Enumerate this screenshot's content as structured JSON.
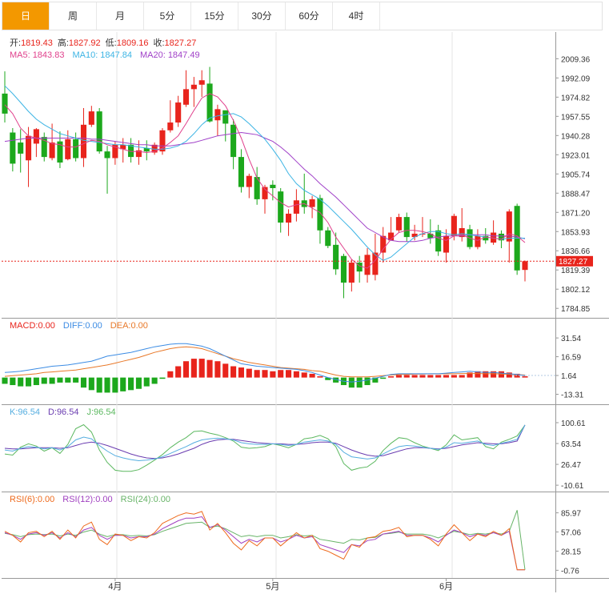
{
  "tabs": [
    {
      "label": "日",
      "active": true
    },
    {
      "label": "周",
      "active": false
    },
    {
      "label": "月",
      "active": false
    },
    {
      "label": "5分",
      "active": false
    },
    {
      "label": "15分",
      "active": false
    },
    {
      "label": "30分",
      "active": false
    },
    {
      "label": "60分",
      "active": false
    },
    {
      "label": "4时",
      "active": false
    }
  ],
  "colors": {
    "up": "#e8241c",
    "down": "#1ca81c",
    "ma5": "#e0408c",
    "ma10": "#3cb4e4",
    "ma20": "#a040c8",
    "diff": "#3c8ce4",
    "dea": "#e87828",
    "k": "#56aee0",
    "d": "#6a3cb0",
    "j": "#5cb860",
    "rsi6": "#ee6a1c",
    "rsi12": "#a040c0",
    "rsi24": "#68b468"
  },
  "ohlc": {
    "open_label": "开:",
    "open": "1819.43",
    "high_label": "高:",
    "high": "1827.92",
    "low_label": "低:",
    "low": "1809.16",
    "close_label": "收:",
    "close": "1827.27"
  },
  "ma": {
    "ma5_label": "MA5:",
    "ma5": "1843.83",
    "ma10_label": "MA10:",
    "ma10": "1847.84",
    "ma20_label": "MA20:",
    "ma20": "1847.49"
  },
  "macd_legend": {
    "macd_label": "MACD:",
    "macd": "0.00",
    "diff_label": "DIFF:",
    "diff": "0.00",
    "dea_label": "DEA:",
    "dea": "0.00"
  },
  "kdj_legend": {
    "k_label": "K:",
    "k": "96.54",
    "d_label": "D:",
    "d": "96.54",
    "j_label": "J:",
    "j": "96.54"
  },
  "rsi_legend": {
    "rsi6_label": "RSI(6):",
    "rsi6": "0.00",
    "rsi12_label": "RSI(12):",
    "rsi12": "0.00",
    "rsi24_label": "RSI(24):",
    "rsi24": "0.00"
  },
  "current_price_label": "1827.27",
  "chart_data": [
    {
      "type": "candlestick",
      "panel": "price",
      "ylim": [
        1777.8,
        2030.5
      ],
      "yticks": [
        "2009.36",
        "1992.09",
        "1974.82",
        "1957.55",
        "1940.28",
        "1923.01",
        "1905.74",
        "1888.47",
        "1871.20",
        "1853.93",
        "1836.66",
        "1819.39",
        "1802.12",
        "1784.85"
      ],
      "xticks": [
        {
          "label": "4月",
          "index": 14
        },
        {
          "label": "5月",
          "index": 34
        },
        {
          "label": "6月",
          "index": 56
        }
      ],
      "candles": [
        [
          1978,
          1960,
          1998,
          1952
        ],
        [
          1943,
          1915,
          1947,
          1908
        ],
        [
          1934,
          1924,
          1946,
          1907
        ],
        [
          1918,
          1940,
          1948,
          1894
        ],
        [
          1933,
          1946,
          1947,
          1921
        ],
        [
          1939,
          1921,
          1943,
          1917
        ],
        [
          1920,
          1934,
          1951,
          1918
        ],
        [
          1935,
          1916,
          1944,
          1911
        ],
        [
          1919,
          1937,
          1945,
          1918
        ],
        [
          1937,
          1920,
          1943,
          1917
        ],
        [
          1920,
          1950,
          1965,
          1912
        ],
        [
          1950,
          1962,
          1967,
          1948
        ],
        [
          1962,
          1926,
          1965,
          1924
        ],
        [
          1926,
          1920,
          1931,
          1888
        ],
        [
          1920,
          1932,
          1935,
          1914
        ],
        [
          1928,
          1932,
          1938,
          1916
        ],
        [
          1932,
          1921,
          1938,
          1916
        ],
        [
          1921,
          1927,
          1936,
          1914
        ],
        [
          1929,
          1926,
          1936,
          1918
        ],
        [
          1925,
          1932,
          1934,
          1923
        ],
        [
          1926,
          1945,
          1947,
          1923
        ],
        [
          1945,
          1952,
          1972,
          1943
        ],
        [
          1952,
          1970,
          1976,
          1948
        ],
        [
          1968,
          1982,
          1999,
          1966
        ],
        [
          1982,
          1986,
          1993,
          1966
        ],
        [
          1986,
          1990,
          1999,
          1975
        ],
        [
          1987,
          1953,
          2002,
          1952
        ],
        [
          1954,
          1964,
          1968,
          1940
        ],
        [
          1963,
          1951,
          1960,
          1935
        ],
        [
          1950,
          1921,
          1955,
          1910
        ],
        [
          1921,
          1894,
          1928,
          1889
        ],
        [
          1894,
          1904,
          1906,
          1884
        ],
        [
          1903,
          1883,
          1912,
          1878
        ],
        [
          1883,
          1894,
          1896,
          1870
        ],
        [
          1896,
          1893,
          1900,
          1882
        ],
        [
          1890,
          1862,
          1893,
          1853
        ],
        [
          1862,
          1870,
          1874,
          1850
        ],
        [
          1870,
          1882,
          1892,
          1863
        ],
        [
          1882,
          1876,
          1906,
          1870
        ],
        [
          1876,
          1883,
          1886,
          1866
        ],
        [
          1884,
          1855,
          1887,
          1843
        ],
        [
          1855,
          1841,
          1858,
          1839
        ],
        [
          1842,
          1820,
          1853,
          1815
        ],
        [
          1832,
          1808,
          1834,
          1794
        ],
        [
          1808,
          1826,
          1829,
          1800
        ],
        [
          1826,
          1818,
          1832,
          1808
        ],
        [
          1815,
          1833,
          1839,
          1808
        ],
        [
          1815,
          1835,
          1852,
          1810
        ],
        [
          1835,
          1850,
          1858,
          1826
        ],
        [
          1846,
          1853,
          1867,
          1848
        ],
        [
          1855,
          1867,
          1870,
          1853
        ],
        [
          1867,
          1849,
          1871,
          1845
        ],
        [
          1849,
          1852,
          1860,
          1846
        ],
        [
          1852,
          1852,
          1867,
          1849
        ],
        [
          1852,
          1848,
          1865,
          1843
        ],
        [
          1855,
          1836,
          1860,
          1832
        ],
        [
          1835,
          1850,
          1856,
          1826
        ],
        [
          1850,
          1868,
          1870,
          1846
        ],
        [
          1849,
          1857,
          1875,
          1845
        ],
        [
          1856,
          1840,
          1860,
          1838
        ],
        [
          1840,
          1850,
          1856,
          1838
        ],
        [
          1850,
          1846,
          1857,
          1843
        ],
        [
          1844,
          1853,
          1864,
          1842
        ],
        [
          1852,
          1846,
          1855,
          1839
        ],
        [
          1845,
          1872,
          1874,
          1826
        ],
        [
          1877,
          1819,
          1879,
          1815
        ],
        [
          1819.43,
          1827.27,
          1827.92,
          1809.16
        ]
      ],
      "ma5": [
        1968,
        1960,
        1947,
        1940,
        1938,
        1936,
        1933,
        1932,
        1930,
        1930,
        1933,
        1936,
        1935,
        1932,
        1930,
        1928,
        1926,
        1926,
        1925,
        1926,
        1929,
        1934,
        1940,
        1951,
        1963,
        1974,
        1978,
        1975,
        1967,
        1954,
        1938,
        1919,
        1902,
        1892,
        1886,
        1880,
        1876,
        1878,
        1879,
        1875,
        1871,
        1862,
        1849,
        1839,
        1829,
        1823,
        1821,
        1828,
        1838,
        1847,
        1853,
        1855,
        1855,
        1854,
        1852,
        1848,
        1846,
        1850,
        1851,
        1848,
        1846,
        1849,
        1848,
        1847,
        1852,
        1850,
        1844
      ],
      "ma10": [
        1985,
        1978,
        1970,
        1962,
        1955,
        1950,
        1946,
        1942,
        1940,
        1938,
        1936,
        1935,
        1934,
        1933,
        1932,
        1932,
        1931,
        1930,
        1929,
        1928,
        1928,
        1929,
        1931,
        1935,
        1942,
        1950,
        1956,
        1958,
        1959,
        1960,
        1957,
        1951,
        1944,
        1937,
        1928,
        1918,
        1906,
        1897,
        1891,
        1887,
        1883,
        1877,
        1870,
        1863,
        1856,
        1848,
        1840,
        1833,
        1828,
        1831,
        1837,
        1843,
        1849,
        1852,
        1854,
        1854,
        1852,
        1851,
        1852,
        1851,
        1850,
        1849,
        1848,
        1847,
        1848,
        1848,
        1848
      ],
      "ma20": [
        1935,
        1936,
        1937,
        1938,
        1938,
        1938,
        1938,
        1938,
        1938,
        1938,
        1938,
        1937,
        1937,
        1936,
        1935,
        1934,
        1933,
        1932,
        1932,
        1931,
        1931,
        1931,
        1932,
        1933,
        1934,
        1936,
        1938,
        1940,
        1941,
        1942,
        1943,
        1942,
        1941,
        1938,
        1935,
        1930,
        1924,
        1917,
        1910,
        1904,
        1897,
        1891,
        1885,
        1878,
        1871,
        1864,
        1857,
        1853,
        1849,
        1846,
        1845,
        1845,
        1845,
        1846,
        1848,
        1849,
        1850,
        1850,
        1850,
        1851,
        1851,
        1851,
        1850,
        1850,
        1850,
        1849,
        1847.5
      ]
    },
    {
      "type": "macd",
      "panel": "macd",
      "ylim": [
        -20.0,
        38.0
      ],
      "yticks": [
        "31.54",
        "16.59",
        "1.64",
        "-13.31"
      ],
      "macd": [
        -5,
        -6,
        -7,
        -7,
        -6,
        -5,
        -5,
        -4,
        -4,
        -4,
        -8,
        -10,
        -12,
        -12,
        -12,
        -11,
        -10,
        -9,
        -7,
        -5,
        -1,
        5,
        9,
        13,
        15,
        15,
        14,
        13,
        11,
        9,
        8,
        7,
        6,
        6,
        5,
        6,
        6,
        5,
        4,
        3,
        1,
        -2,
        -4,
        -6,
        -8,
        -8,
        -6,
        -4,
        -1,
        1,
        2,
        2,
        2,
        2,
        2,
        2,
        2,
        2,
        2,
        4,
        5,
        5,
        5,
        5,
        4,
        3,
        1
      ],
      "diff": [
        4,
        4.5,
        5,
        6,
        7,
        8,
        9,
        9.5,
        10,
        11,
        12,
        13,
        15,
        17,
        18,
        19,
        20,
        21.5,
        23,
        24.5,
        25.5,
        26.5,
        27,
        27,
        26,
        25,
        23,
        20,
        17,
        14,
        11,
        10,
        9,
        8.5,
        8,
        7.5,
        7,
        6.5,
        5.5,
        4,
        2,
        0,
        -1.5,
        -3,
        -3.5,
        -3,
        -2,
        -0.5,
        1,
        2.5,
        3,
        3,
        3,
        3,
        3,
        3,
        3.5,
        4,
        4.5,
        5,
        4.5,
        4,
        4,
        3.5,
        3,
        2.5,
        1.5
      ],
      "dea": [
        1,
        1.5,
        2,
        2.5,
        3,
        4,
        4.5,
        5,
        5.5,
        6,
        7,
        8,
        9,
        10,
        11.5,
        13,
        14.5,
        16,
        18,
        20,
        21.5,
        23,
        24,
        24.5,
        24,
        23,
        21,
        19,
        17,
        15,
        13.5,
        12,
        11,
        10,
        9,
        8,
        7.5,
        7,
        6.5,
        5.5,
        5,
        3.5,
        2,
        1,
        0.5,
        0.5,
        0.5,
        1,
        1.5,
        2,
        2.5,
        2.5,
        2.8,
        2.8,
        3,
        3,
        3,
        3,
        3.2,
        3.2,
        3.2,
        3,
        3,
        2.8,
        2.6,
        2.4,
        2
      ]
    },
    {
      "type": "kdj",
      "panel": "kdj",
      "ylim": [
        -19.0,
        112.0
      ],
      "yticks": [
        "100.61",
        "63.54",
        "26.47",
        "-10.61"
      ],
      "k": [
        52,
        50,
        55,
        58,
        57,
        54,
        56,
        52,
        58,
        70,
        75,
        72,
        60,
        50,
        42,
        38,
        35,
        33,
        34,
        36,
        40,
        46,
        52,
        58,
        65,
        70,
        72,
        73,
        72,
        70,
        65,
        63,
        62,
        62,
        63,
        62,
        60,
        62,
        66,
        68,
        70,
        68,
        62,
        48,
        40,
        38,
        36,
        38,
        45,
        52,
        58,
        60,
        59,
        57,
        55,
        53,
        57,
        65,
        64,
        66,
        68,
        62,
        60,
        64,
        67,
        71,
        96.5
      ],
      "d": [
        55,
        54,
        54,
        55,
        56,
        56,
        56,
        55,
        56,
        60,
        64,
        66,
        64,
        60,
        55,
        50,
        45,
        41,
        38,
        37,
        38,
        41,
        45,
        50,
        55,
        62,
        67,
        70,
        71,
        71,
        69,
        67,
        65,
        64,
        63,
        63,
        62,
        62,
        63,
        65,
        66,
        66,
        64,
        58,
        52,
        47,
        43,
        41,
        42,
        46,
        50,
        54,
        56,
        56,
        55,
        54,
        55,
        58,
        61,
        63,
        65,
        64,
        63,
        63,
        65,
        68,
        96.5
      ],
      "j": [
        45,
        43,
        57,
        63,
        59,
        50,
        56,
        46,
        62,
        90,
        97,
        84,
        52,
        30,
        16,
        14,
        14,
        17,
        25,
        34,
        44,
        56,
        66,
        74,
        85,
        86,
        82,
        79,
        74,
        68,
        57,
        55,
        56,
        58,
        63,
        60,
        56,
        62,
        72,
        74,
        78,
        72,
        58,
        28,
        16,
        20,
        22,
        32,
        51,
        64,
        74,
        72,
        65,
        59,
        55,
        51,
        61,
        79,
        70,
        72,
        74,
        58,
        54,
        66,
        71,
        77,
        96.5
      ]
    },
    {
      "type": "rsi",
      "panel": "rsi",
      "ylim": [
        -10.0,
        100.0
      ],
      "yticks": [
        "85.97",
        "57.06",
        "28.15",
        "-0.76"
      ],
      "rsi6": [
        58,
        52,
        42,
        56,
        58,
        50,
        58,
        46,
        60,
        48,
        66,
        72,
        46,
        38,
        54,
        52,
        44,
        50,
        48,
        56,
        70,
        76,
        82,
        86,
        84,
        88,
        60,
        70,
        56,
        40,
        30,
        44,
        36,
        48,
        48,
        36,
        46,
        56,
        48,
        52,
        32,
        28,
        22,
        16,
        38,
        34,
        48,
        50,
        58,
        60,
        64,
        50,
        52,
        52,
        46,
        36,
        54,
        68,
        56,
        44,
        54,
        50,
        58,
        52,
        62,
        0,
        0
      ],
      "rsi12": [
        56,
        52,
        46,
        54,
        56,
        52,
        56,
        48,
        56,
        50,
        60,
        64,
        52,
        46,
        52,
        52,
        48,
        50,
        50,
        54,
        62,
        68,
        74,
        78,
        78,
        80,
        64,
        68,
        60,
        50,
        40,
        46,
        42,
        48,
        48,
        42,
        46,
        52,
        48,
        50,
        38,
        34,
        30,
        26,
        38,
        36,
        44,
        46,
        54,
        56,
        58,
        52,
        52,
        52,
        48,
        42,
        52,
        60,
        56,
        50,
        54,
        52,
        56,
        52,
        58,
        0,
        0
      ],
      "rsi24": [
        55,
        53,
        50,
        53,
        54,
        53,
        54,
        51,
        54,
        52,
        57,
        60,
        54,
        50,
        53,
        53,
        51,
        52,
        51,
        53,
        58,
        62,
        66,
        70,
        71,
        72,
        64,
        66,
        62,
        56,
        50,
        52,
        50,
        52,
        52,
        48,
        50,
        53,
        51,
        52,
        46,
        44,
        42,
        40,
        46,
        45,
        48,
        49,
        54,
        55,
        57,
        54,
        54,
        54,
        52,
        48,
        53,
        58,
        56,
        53,
        55,
        54,
        56,
        54,
        58,
        90,
        0
      ]
    }
  ]
}
